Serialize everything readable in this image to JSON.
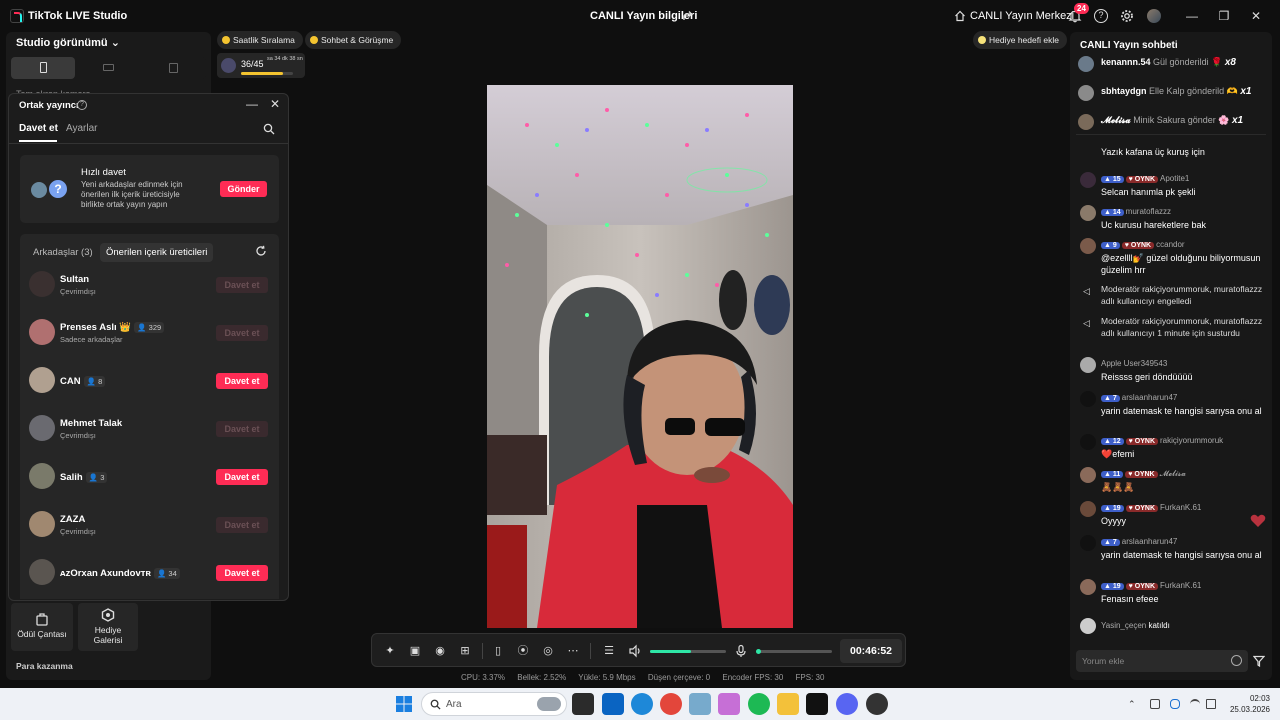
{
  "titlebar": {
    "app_name": "TikTok LIVE Studio",
    "live_info": "CANLI Yayın bilgileri",
    "live_center": "CANLI Yayın Merkezi",
    "notif_count": "24"
  },
  "left": {
    "studio_view": "Studio görünümü",
    "hidden_label": "Tam ekran kamera",
    "odul": "Ödül Çantası",
    "galeri": "Hediye Galerisi",
    "para": "Para kazanma"
  },
  "chips": {
    "hourly": "Saatlik Sıralama",
    "chat_meet": "Sohbet & Görüşme",
    "gift_goal": "Hediye hedefi ekle"
  },
  "goal": {
    "count": "36/45",
    "time": "sa 34 dk 38 sn",
    "progress": 0.8
  },
  "modal": {
    "title": "Ortak yayıncı",
    "tab_invite": "Davet et",
    "tab_settings": "Ayarlar",
    "quick_title": "Hızlı davet",
    "quick_desc": "Yeni arkadaşlar edinmek için önerilen ilk içerik üreticisiyle birlikte ortak yayın yapın",
    "send": "Gönder",
    "tab_friends": "Arkadaşlar (3)",
    "tab_suggested": "Önerilen içerik üreticileri",
    "rows": [
      {
        "name": "Sultan",
        "sub": "Çevrimdışı",
        "badge": "",
        "btn": "Davet et",
        "enabled": false
      },
      {
        "name": "Prenses Aslı 👑",
        "sub": "Sadece arkadaşlar",
        "badge": "329",
        "btn": "Davet et",
        "enabled": false
      },
      {
        "name": "CAN",
        "sub": "",
        "badge": "8",
        "btn": "Davet et",
        "enabled": true
      },
      {
        "name": "Mehmet Talak",
        "sub": "Çevrimdışı",
        "badge": "",
        "btn": "Davet et",
        "enabled": false
      },
      {
        "name": "Salih",
        "sub": "",
        "badge": "3",
        "btn": "Davet et",
        "enabled": true
      },
      {
        "name": "ZAZA",
        "sub": "Çevrimdışı",
        "badge": "",
        "btn": "Davet et",
        "enabled": false
      },
      {
        "name": "ᴀᴢOrxan Axundovᴛʀ",
        "sub": "",
        "badge": "34",
        "btn": "Davet et",
        "enabled": true
      }
    ]
  },
  "toolbar": {
    "timer": "00:46:52"
  },
  "stats": {
    "cpu": "CPU: 3.37%",
    "mem": "Bellek: 2.52%",
    "upload": "Yükle: 5.9 Mbps",
    "drop": "Düşen çerçeve: 0",
    "enc": "Encoder FPS: 30",
    "fps": "FPS: 30"
  },
  "chat": {
    "title": "CANLI Yayın sohbeti",
    "gifts": [
      {
        "user": "kenannn.54",
        "text": "Gül gönderildi",
        "count": "x8",
        "emoji": "🌹"
      },
      {
        "user": "sbhtaydgn",
        "text": "Elle Kalp gönderild",
        "count": "x1",
        "emoji": "🫶"
      },
      {
        "user": "𝓜𝓮𝓵𝓲𝓼𝓪",
        "text": "Minik Sakura gönder",
        "count": "x1",
        "emoji": "🌸"
      }
    ],
    "messages": [
      {
        "lvl": "",
        "oynk": false,
        "user": "",
        "text": "Yazık kafana üç kuruş için"
      },
      {
        "lvl": "15",
        "oynk": true,
        "user": "Apotite1",
        "text": "Selcan hanımla pk şekli"
      },
      {
        "lvl": "14",
        "oynk": false,
        "user": "muratoflazzz",
        "text": "Uc kurusu hareketlere bak"
      },
      {
        "lvl": "9",
        "oynk": true,
        "user": "ccandor",
        "text": "@ezellll💅 güzel olduğunu biliyormusun güzelim hrr"
      },
      {
        "lvl": "",
        "oynk": false,
        "user": "Moderatör rakiçiyorummoruk, muratoflazzz adlı kullanıcıyı engelledi",
        "text": "",
        "system": true
      },
      {
        "lvl": "",
        "oynk": false,
        "user": "Moderatör rakiçiyorummoruk, muratoflazzz adlı kullanıcıyı 1 minute için susturdu",
        "text": "",
        "system": true
      },
      {
        "lvl": "",
        "oynk": false,
        "user": "Apple User349543",
        "text": "Reissss geri döndüüüü"
      },
      {
        "lvl": "7",
        "oynk": false,
        "user": "arslaanharun47",
        "text": "yarin datemask te hangisi sarıysa onu al"
      },
      {
        "lvl": "12",
        "oynk": true,
        "user": "rakiçiyorummoruk",
        "text": "❤️efemi"
      },
      {
        "lvl": "11",
        "oynk": true,
        "user": "𝓜𝓮𝓵𝓲𝓼𝓪",
        "text": "🧸🧸🧸"
      },
      {
        "lvl": "19",
        "oynk": true,
        "user": "FurkanK.61",
        "text": "Oyyyy"
      },
      {
        "lvl": "7",
        "oynk": false,
        "user": "arslaanharun47",
        "text": "yarin datemask te hangisi sarıysa onu al"
      },
      {
        "lvl": "19",
        "oynk": true,
        "user": "FurkanK.61",
        "text": "Fenasın efeee"
      },
      {
        "lvl": "",
        "oynk": false,
        "user": "Yasin_çeçen",
        "text": "katıldı",
        "joined": true
      }
    ],
    "oynk_label": "OYNK",
    "input_placeholder": "Yorum ekle"
  },
  "taskbar": {
    "search": "Ara",
    "time": "02:03",
    "date": "25.03.2026"
  }
}
